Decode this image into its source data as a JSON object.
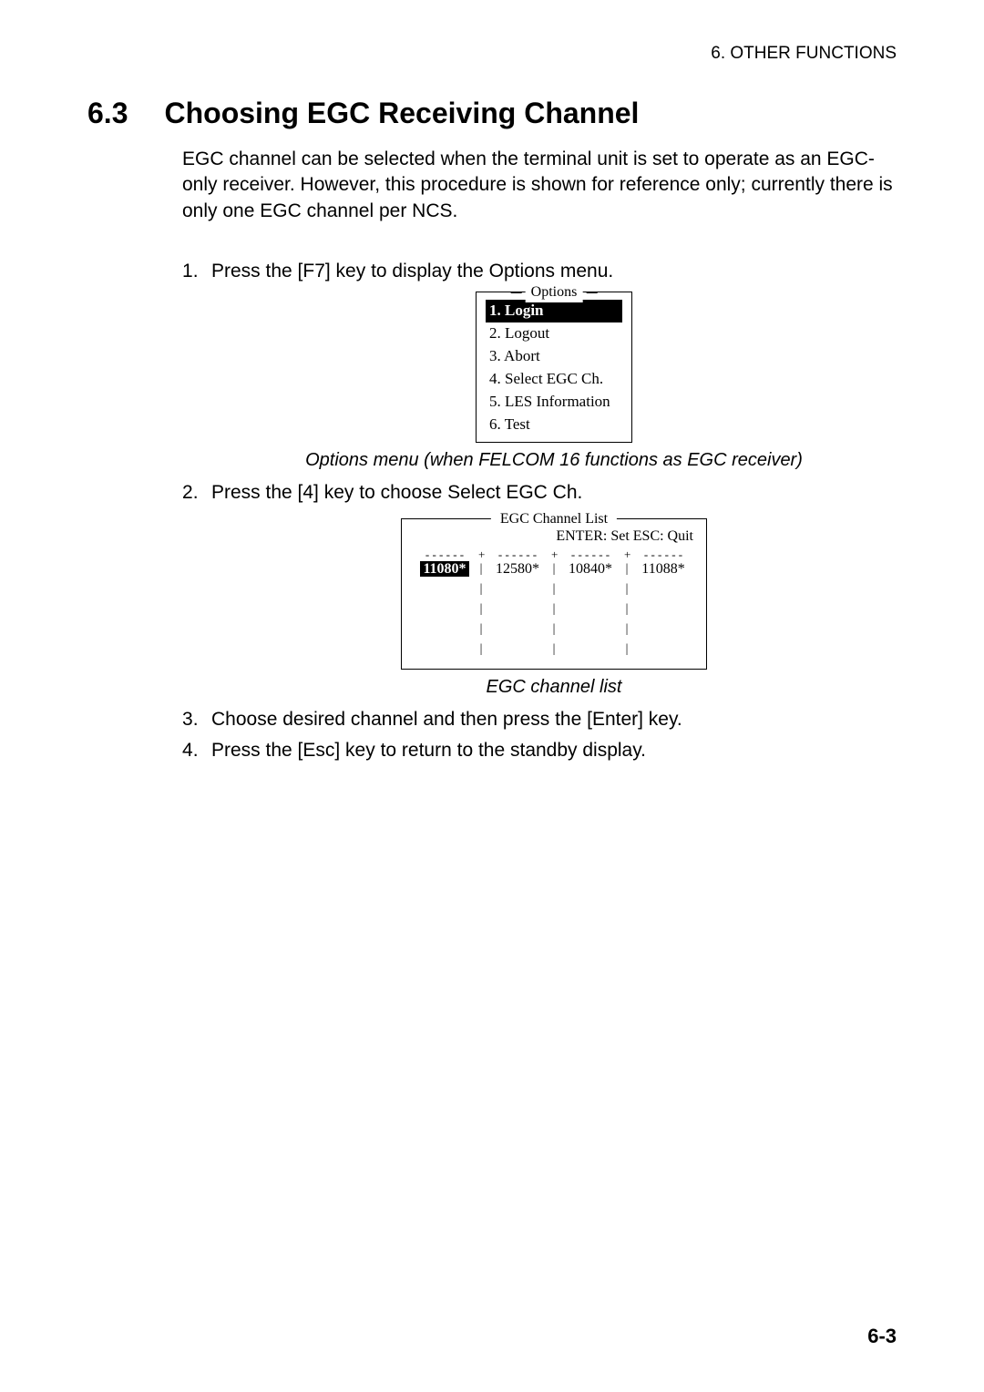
{
  "running_header": "6. OTHER FUNCTIONS",
  "section_number": "6.3",
  "section_title": "Choosing EGC Receiving Channel",
  "intro_paragraph": "EGC channel can be selected when the terminal unit is set to operate as an EGC-only receiver. However, this procedure is shown for reference only; currently there is only one EGC channel per NCS.",
  "steps": {
    "s1": "Press the [F7] key to display the Options menu.",
    "s2": "Press the [4] key to choose Select EGC Ch.",
    "s3": "Choose desired channel and then press the [Enter] key.",
    "s4": "Press the [Esc] key to return to the standby display."
  },
  "options_menu": {
    "title": "Options",
    "items": {
      "i1": "1. Login",
      "i2": "2. Logout",
      "i3": "3. Abort",
      "i4": "4. Select EGC Ch.",
      "i5": "5. LES Information",
      "i6": "6. Test"
    }
  },
  "options_caption": "Options menu (when FELCOM 16 functions as EGC receiver)",
  "egc": {
    "title": "EGC Channel List",
    "hint": "ENTER: Set   ESC: Quit",
    "sep": "- - - - - -",
    "plus": "+",
    "bar": "|",
    "cells": {
      "c1": "11080*",
      "c2": "12580*",
      "c3": "10840*",
      "c4": "11088*"
    }
  },
  "egc_caption": "EGC channel list",
  "page_number": "6-3"
}
